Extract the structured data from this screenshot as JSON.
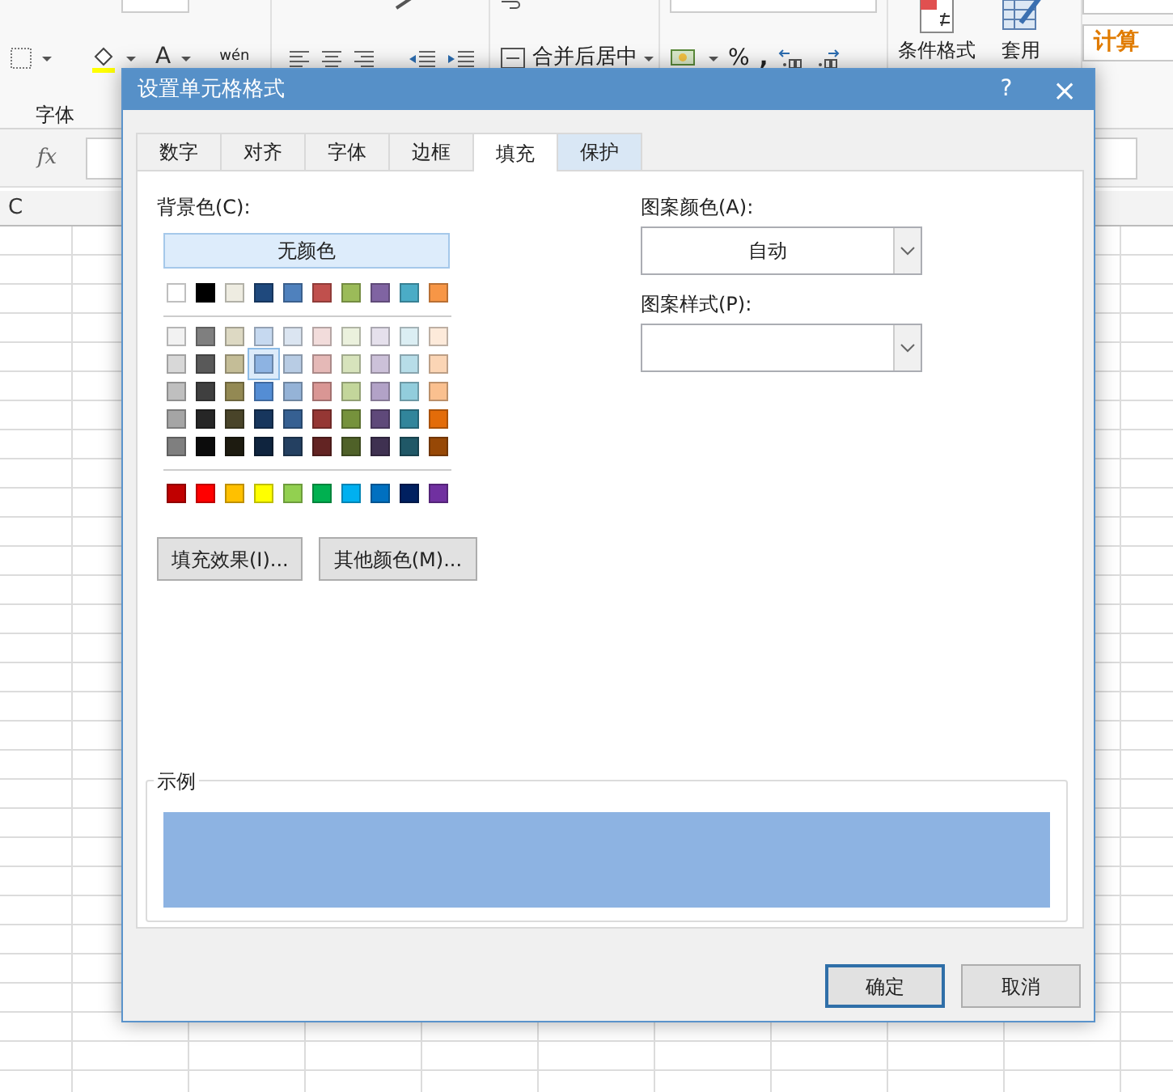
{
  "ribbon": {
    "font_color": "A",
    "phonetic": "wén",
    "font_group": "字体",
    "merge_center": "合并后居中",
    "percent": "%",
    "comma": ",",
    "conditional_format": "条件格式",
    "table_format": "套用",
    "style_calc": "计算"
  },
  "formula_bar": {
    "fx": "fx"
  },
  "sheet": {
    "column": "C"
  },
  "dialog": {
    "title": "设置单元格格式",
    "help": "?",
    "close": "×",
    "tabs": [
      {
        "label": "数字",
        "selected": false,
        "hovered": false
      },
      {
        "label": "对齐",
        "selected": false,
        "hovered": false
      },
      {
        "label": "字体",
        "selected": false,
        "hovered": false
      },
      {
        "label": "边框",
        "selected": false,
        "hovered": false
      },
      {
        "label": "填充",
        "selected": true,
        "hovered": false
      },
      {
        "label": "保护",
        "selected": false,
        "hovered": true
      }
    ],
    "fill": {
      "background_label": "背景色(C):",
      "no_color": "无颜色",
      "theme_colors": [
        {
          "color": "#ffffff",
          "selected": false
        },
        {
          "color": "#000000",
          "selected": false
        },
        {
          "color": "#eeece1",
          "selected": false
        },
        {
          "color": "#1f497d",
          "selected": false
        },
        {
          "color": "#4f81bd",
          "selected": false
        },
        {
          "color": "#c0504d",
          "selected": false
        },
        {
          "color": "#9bbb59",
          "selected": false
        },
        {
          "color": "#8064a2",
          "selected": false
        },
        {
          "color": "#4bacc6",
          "selected": false
        },
        {
          "color": "#f79646",
          "selected": false
        }
      ],
      "tints": [
        [
          {
            "color": "#f2f2f2",
            "selected": false
          },
          {
            "color": "#7f7f7f",
            "selected": false
          },
          {
            "color": "#ddd9c3",
            "selected": false
          },
          {
            "color": "#c6d9f0",
            "selected": false
          },
          {
            "color": "#dbe5f1",
            "selected": false
          },
          {
            "color": "#f2dcdb",
            "selected": false
          },
          {
            "color": "#ebf1dd",
            "selected": false
          },
          {
            "color": "#e5e0ec",
            "selected": false
          },
          {
            "color": "#dbeef3",
            "selected": false
          },
          {
            "color": "#fdeada",
            "selected": false
          }
        ],
        [
          {
            "color": "#d8d8d8",
            "selected": false
          },
          {
            "color": "#595959",
            "selected": false
          },
          {
            "color": "#c4bd97",
            "selected": false
          },
          {
            "color": "#8db3e2",
            "selected": true
          },
          {
            "color": "#b8cce4",
            "selected": false
          },
          {
            "color": "#e5b9b7",
            "selected": false
          },
          {
            "color": "#d7e3bc",
            "selected": false
          },
          {
            "color": "#ccc1d9",
            "selected": false
          },
          {
            "color": "#b7dde8",
            "selected": false
          },
          {
            "color": "#fbd5b5",
            "selected": false
          }
        ],
        [
          {
            "color": "#bfbfbf",
            "selected": false
          },
          {
            "color": "#3f3f3f",
            "selected": false
          },
          {
            "color": "#938953",
            "selected": false
          },
          {
            "color": "#548dd4",
            "selected": false
          },
          {
            "color": "#95b3d7",
            "selected": false
          },
          {
            "color": "#d99694",
            "selected": false
          },
          {
            "color": "#c3d69b",
            "selected": false
          },
          {
            "color": "#b2a2c7",
            "selected": false
          },
          {
            "color": "#92cddc",
            "selected": false
          },
          {
            "color": "#fac08f",
            "selected": false
          }
        ],
        [
          {
            "color": "#a5a5a5",
            "selected": false
          },
          {
            "color": "#262626",
            "selected": false
          },
          {
            "color": "#494429",
            "selected": false
          },
          {
            "color": "#17365d",
            "selected": false
          },
          {
            "color": "#366092",
            "selected": false
          },
          {
            "color": "#953734",
            "selected": false
          },
          {
            "color": "#76923c",
            "selected": false
          },
          {
            "color": "#5f497a",
            "selected": false
          },
          {
            "color": "#31859b",
            "selected": false
          },
          {
            "color": "#e36c09",
            "selected": false
          }
        ],
        [
          {
            "color": "#7f7f7f",
            "selected": false
          },
          {
            "color": "#0c0c0c",
            "selected": false
          },
          {
            "color": "#1d1b10",
            "selected": false
          },
          {
            "color": "#0f243e",
            "selected": false
          },
          {
            "color": "#244061",
            "selected": false
          },
          {
            "color": "#632423",
            "selected": false
          },
          {
            "color": "#4f6128",
            "selected": false
          },
          {
            "color": "#3f3151",
            "selected": false
          },
          {
            "color": "#205867",
            "selected": false
          },
          {
            "color": "#974806",
            "selected": false
          }
        ]
      ],
      "standard_colors": [
        {
          "color": "#c00000",
          "selected": false
        },
        {
          "color": "#ff0000",
          "selected": false
        },
        {
          "color": "#ffc000",
          "selected": false
        },
        {
          "color": "#ffff00",
          "selected": false
        },
        {
          "color": "#92d050",
          "selected": false
        },
        {
          "color": "#00b050",
          "selected": false
        },
        {
          "color": "#00b0f0",
          "selected": false
        },
        {
          "color": "#0070c0",
          "selected": false
        },
        {
          "color": "#002060",
          "selected": false
        },
        {
          "color": "#7030a0",
          "selected": false
        }
      ],
      "fill_effects": "填充效果(I)...",
      "more_colors": "其他颜色(M)...",
      "pattern_color_label": "图案颜色(A):",
      "pattern_color": "自动",
      "pattern_style_label": "图案样式(P):",
      "sample_label": "示例"
    },
    "buttons": [
      {
        "label": "确定",
        "default": true
      },
      {
        "label": "取消",
        "default": false
      }
    ]
  }
}
